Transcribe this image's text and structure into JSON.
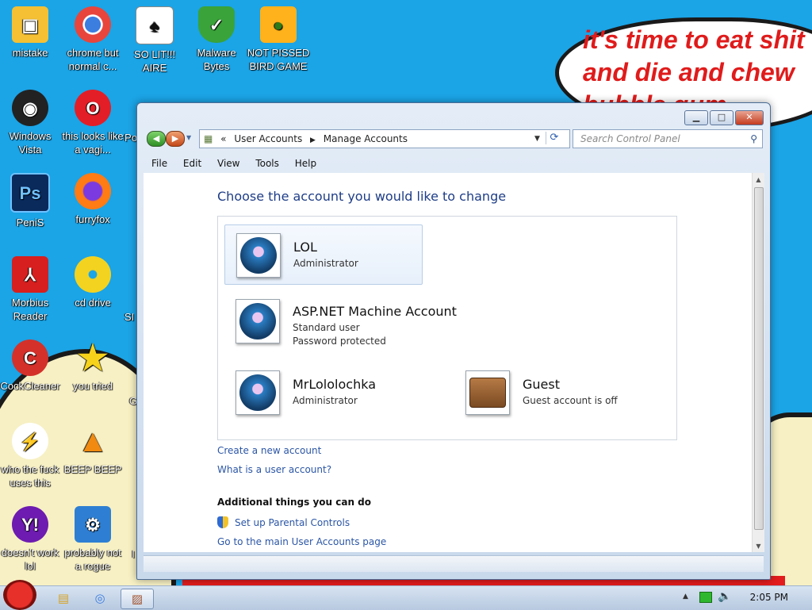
{
  "desktop": {
    "speech_text": [
      "it's time to eat shit",
      "and die and chew",
      "bubble gum"
    ],
    "icons": [
      {
        "label": "mistake",
        "icon": "computer-icon",
        "color": "#f5c033"
      },
      {
        "label": "chrome but normal c...",
        "icon": "chrome-icon",
        "color": "#3c7de0"
      },
      {
        "label": "SO LIT!!! AIRE",
        "icon": "solitaire-icon",
        "color": "#ffffff"
      },
      {
        "label": "Malware Bytes",
        "icon": "shield-icon",
        "color": "#3aa33a"
      },
      {
        "label": "NOT PISSED BIRD GAME",
        "icon": "pig-icon",
        "color": "#ffb21b"
      },
      {
        "label": "Windows Vista",
        "icon": "vista-icon",
        "color": "#222222"
      },
      {
        "label": "this looks like a vagi...",
        "icon": "opera-icon",
        "color": "#e41e26"
      },
      {
        "label": "PeniS",
        "icon": "photoshop-icon",
        "color": "#0a2a5c"
      },
      {
        "label": "furryfox",
        "icon": "firefox-icon",
        "color": "#ff7b14"
      },
      {
        "label": "Morbius Reader",
        "icon": "pdf-icon",
        "color": "#d71f1f"
      },
      {
        "label": "cd drive",
        "icon": "cd-icon",
        "color": "#f3d320"
      },
      {
        "label": "CockCleaner",
        "icon": "ccleaner-icon",
        "color": "#d4312a"
      },
      {
        "label": "you tried",
        "icon": "star-icon",
        "color": "#f7d21b"
      },
      {
        "label": "who the fuck uses this",
        "icon": "winamp-icon",
        "color": "#e35b16"
      },
      {
        "label": "BEEP BEEP",
        "icon": "vlc-icon",
        "color": "#f08a11"
      },
      {
        "label": "doesn't work lol",
        "icon": "yahoo-icon",
        "color": "#6d1bb0"
      },
      {
        "label": "probably not a rogue",
        "icon": "settings-icon",
        "color": "#2e7fd3"
      }
    ],
    "partial_labels": [
      "Po",
      "SI",
      "G",
      "I"
    ]
  },
  "window": {
    "address": [
      "User Accounts",
      "Manage Accounts"
    ],
    "search_placeholder": "Search Control Panel",
    "menu": [
      "File",
      "Edit",
      "View",
      "Tools",
      "Help"
    ],
    "heading": "Choose the account you would like to change",
    "accounts": [
      {
        "name": "LOL",
        "lines": [
          "Administrator"
        ],
        "selected": true
      },
      {
        "name": "ASP.NET Machine Account",
        "lines": [
          "Standard user",
          "Password protected"
        ],
        "selected": false
      },
      {
        "name": "MrLololochka",
        "lines": [
          "Administrator"
        ],
        "selected": false
      },
      {
        "name": "Guest",
        "lines": [
          "Guest account is off"
        ],
        "selected": false
      }
    ],
    "links": {
      "create": "Create a new account",
      "what": "What is a user account?"
    },
    "additional_title": "Additional things you can do",
    "additional_links": {
      "parental": "Set up Parental Controls",
      "main_page": "Go to the main User Accounts page"
    }
  },
  "taskbar": {
    "clock": "2:05 PM"
  }
}
